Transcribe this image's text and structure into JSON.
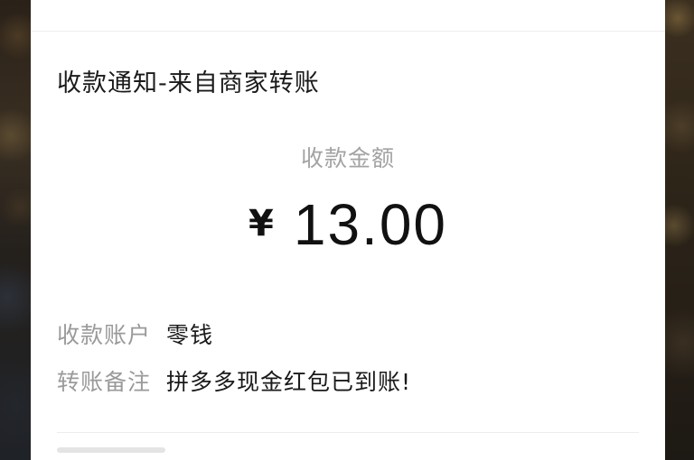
{
  "notification": {
    "title": "收款通知-来自商家转账",
    "amount_label": "收款金额",
    "currency_symbol": "¥",
    "amount": "13.00"
  },
  "details": [
    {
      "label": "收款账户",
      "value": "零钱"
    },
    {
      "label": "转账备注",
      "value": "拼多多现金红包已到账!"
    }
  ]
}
